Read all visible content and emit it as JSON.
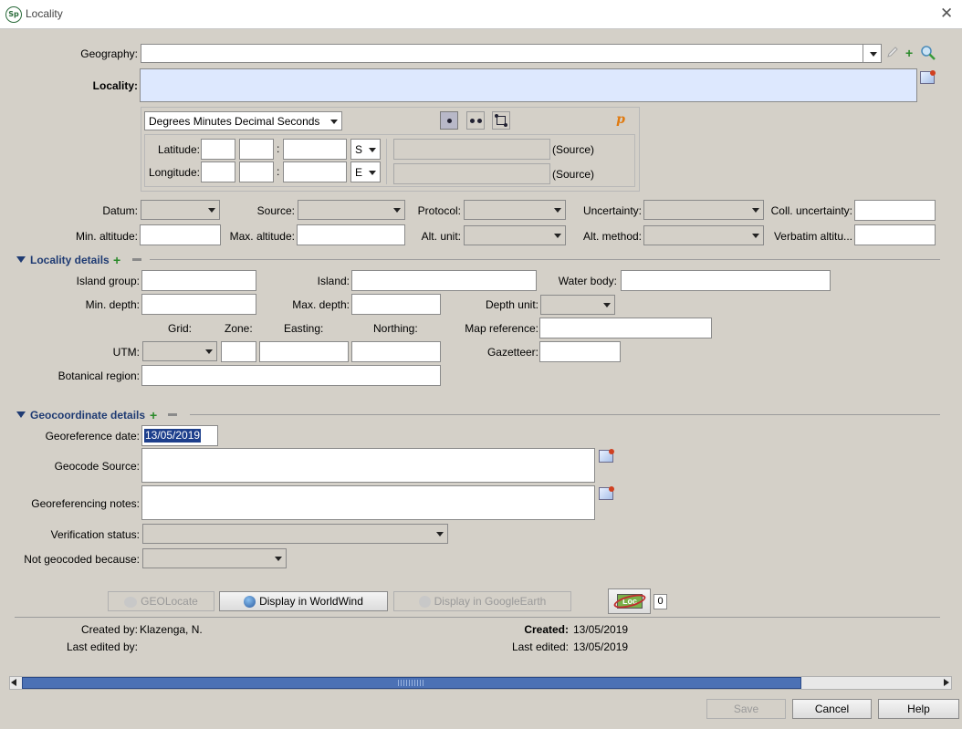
{
  "window": {
    "title": "Locality",
    "close": "✕"
  },
  "form": {
    "geography_label": "Geography:",
    "locality_label": "Locality:",
    "coord_format": "Degrees Minutes Decimal Seconds",
    "latitude_label": "Latitude:",
    "longitude_label": "Longitude:",
    "colon": ":",
    "lat_dir": "S",
    "lon_dir": "E",
    "source_label": "(Source)",
    "p_icon": "p",
    "datum_label": "Datum:",
    "source_field_label": "Source:",
    "protocol_label": "Protocol:",
    "uncertainty_label": "Uncertainty:",
    "coll_uncertainty_label": "Coll. uncertainty:",
    "min_alt_label": "Min. altitude:",
    "max_alt_label": "Max. altitude:",
    "alt_unit_label": "Alt. unit:",
    "alt_method_label": "Alt. method:",
    "verbatim_alt_label": "Verbatim altitu..."
  },
  "locality_details": {
    "title": "Locality details",
    "plus": "+",
    "island_group_label": "Island group:",
    "island_label": "Island:",
    "water_body_label": "Water body:",
    "min_depth_label": "Min. depth:",
    "max_depth_label": "Max. depth:",
    "depth_unit_label": "Depth unit:",
    "grid_label": "Grid:",
    "zone_label": "Zone:",
    "easting_label": "Easting:",
    "northing_label": "Northing:",
    "map_reference_label": "Map reference:",
    "utm_label": "UTM:",
    "gazetteer_label": "Gazetteer:",
    "botanical_region_label": "Botanical region:"
  },
  "geocoordinate_details": {
    "title": "Geocoordinate details",
    "plus": "+",
    "georef_date_label": "Georeference date:",
    "georef_date_value": "13/05/2019",
    "geocode_source_label": "Geocode Source:",
    "georef_notes_label": "Georeferencing notes:",
    "verification_label": "Verification status:",
    "not_geocoded_label": "Not geocoded because:"
  },
  "actions": {
    "geolocate": "GEOLocate",
    "worldwind": "Display in WorldWind",
    "googleearth": "Display in GoogleEarth",
    "loc_icon": "Loc",
    "loc_count": "0"
  },
  "footer": {
    "created_by_label": "Created by:",
    "created_by_value": "Klazenga, N.",
    "last_edited_by_label": "Last edited by:",
    "created_label": "Created:",
    "created_value": "13/05/2019",
    "last_edited_label": "Last edited:",
    "last_edited_value": "13/05/2019"
  },
  "buttons": {
    "save": "Save",
    "cancel": "Cancel",
    "help": "Help"
  },
  "colors": {
    "locality_field": "#dde8fe",
    "section_title": "#1f3b73",
    "scroll_thumb": "#4b71b5",
    "selection": "#1d3f8c"
  }
}
